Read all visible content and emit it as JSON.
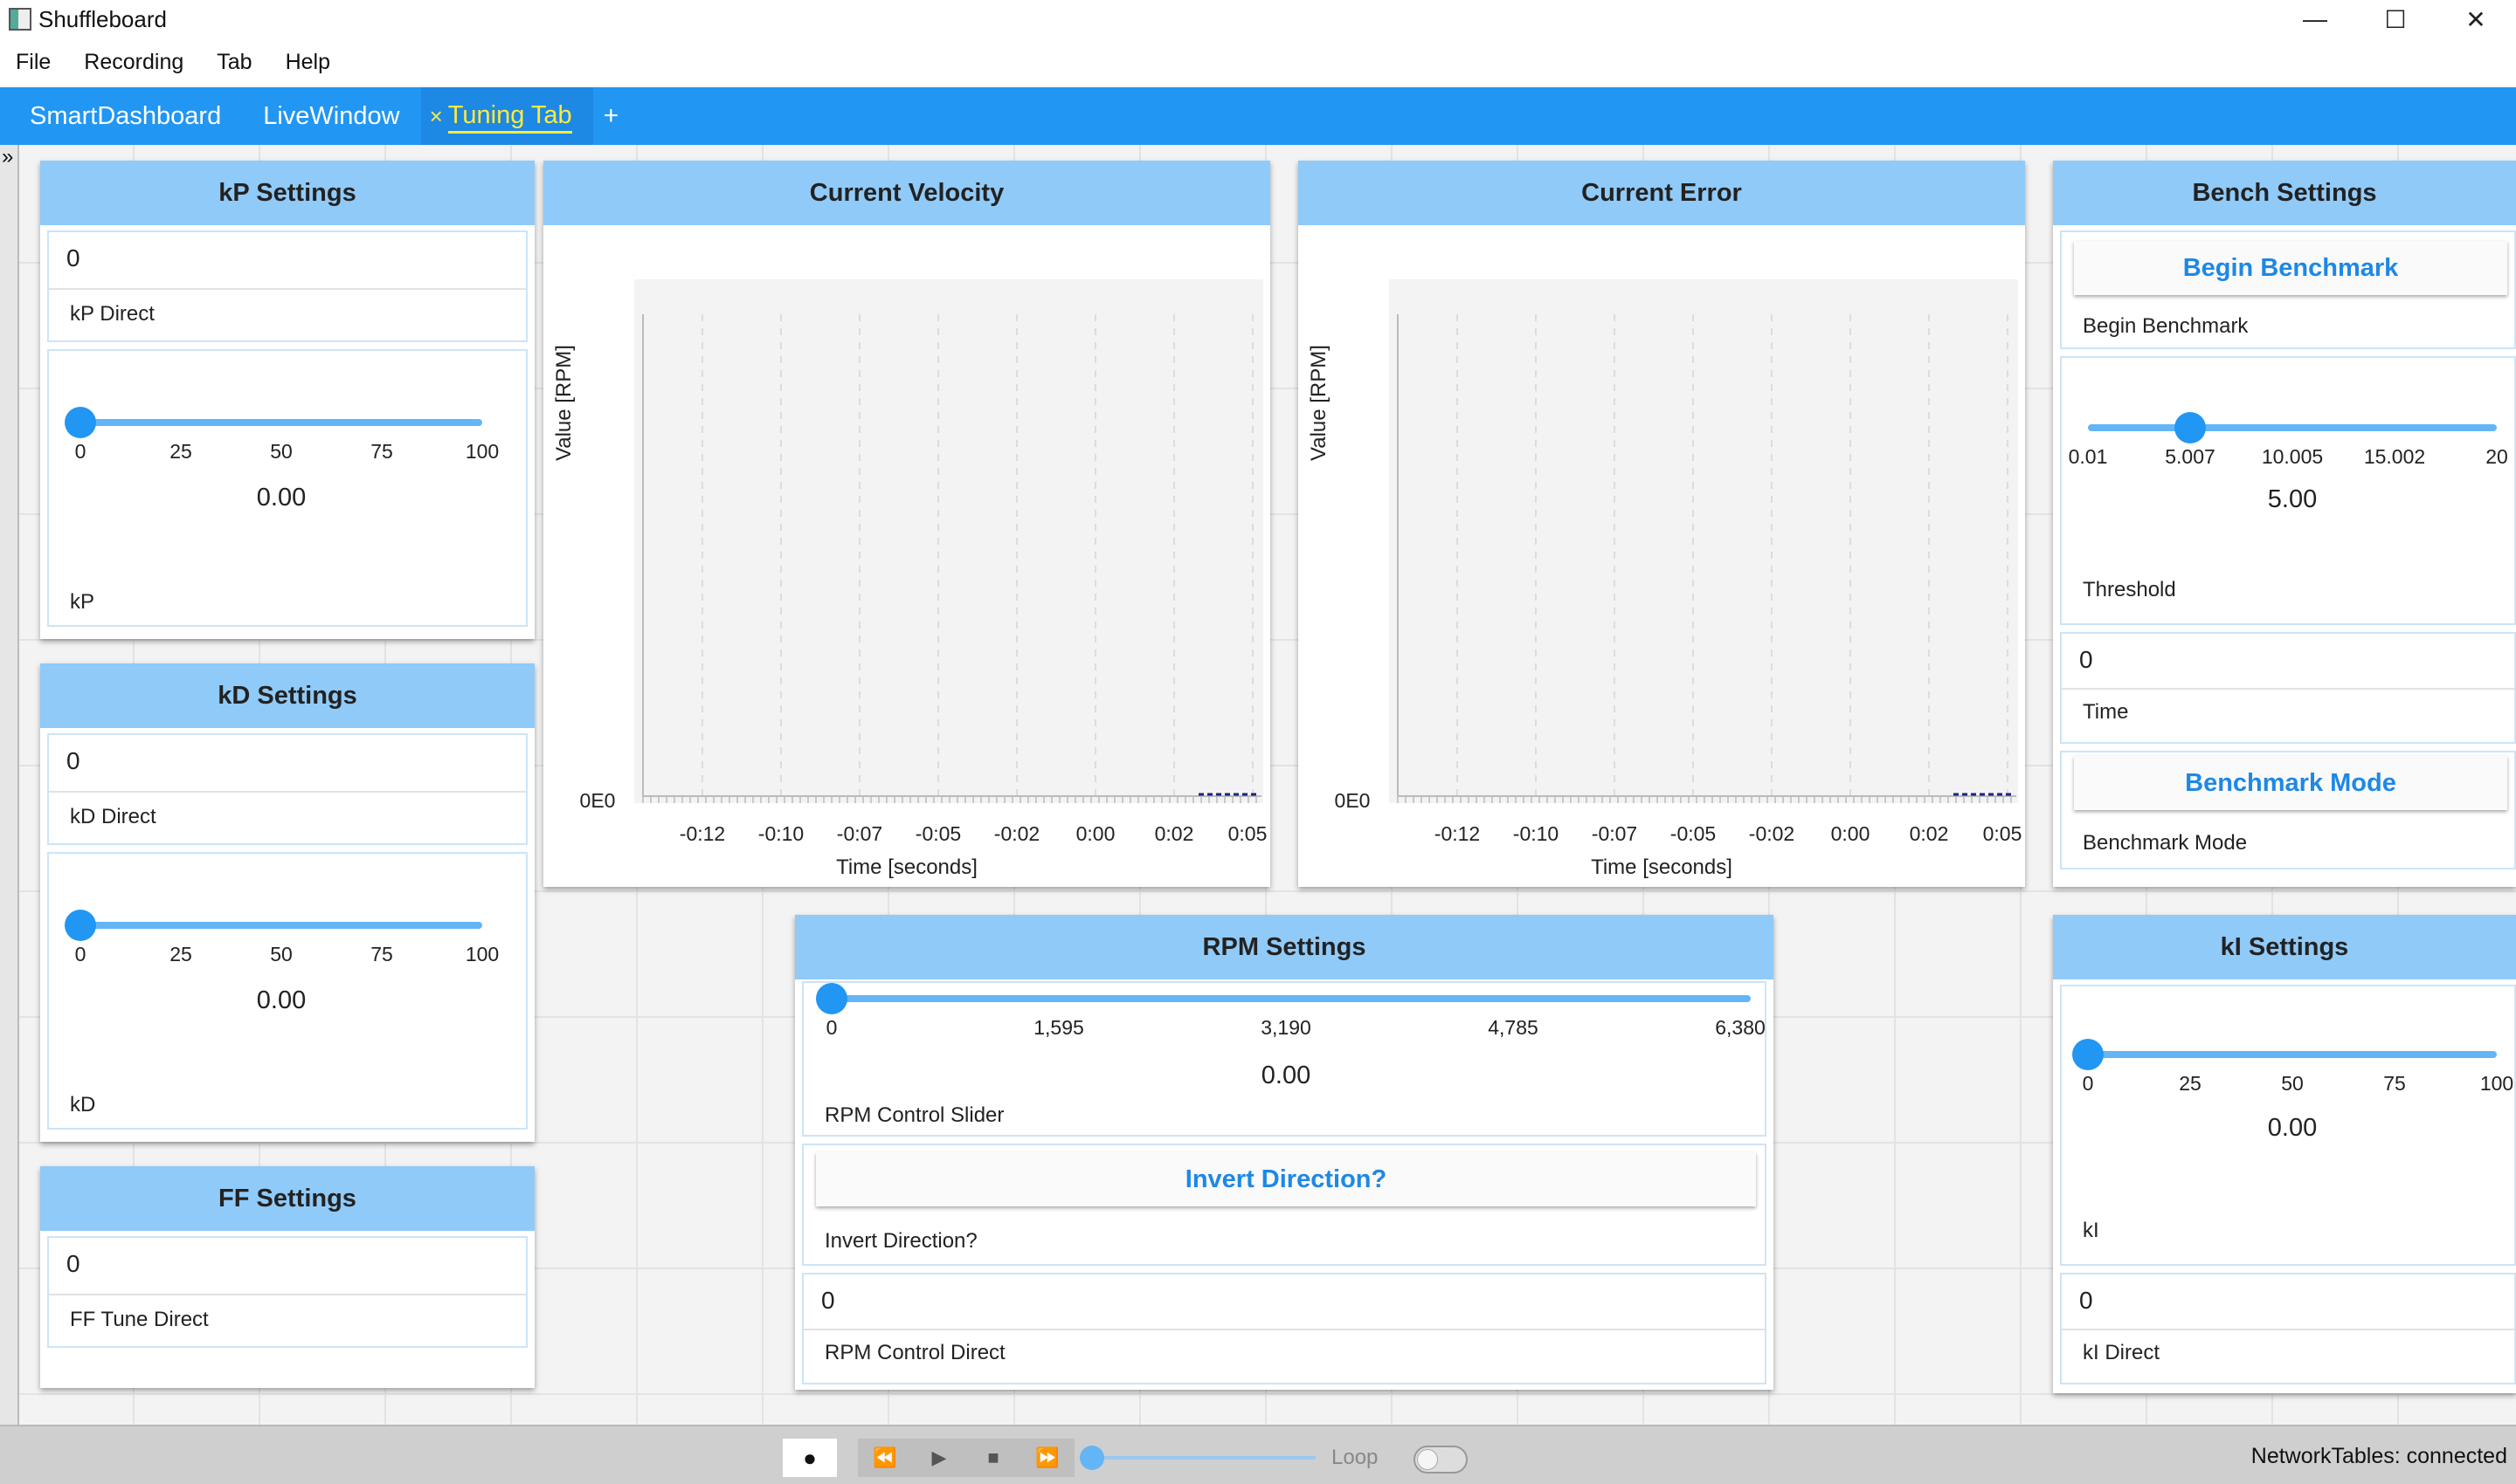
{
  "window": {
    "title": "Shuffleboard",
    "minimize": "—",
    "maximize": "☐",
    "close": "✕"
  },
  "menu": [
    "File",
    "Recording",
    "Tab",
    "Help"
  ],
  "tabs": [
    {
      "label": "SmartDashboard",
      "active": false
    },
    {
      "label": "LiveWindow",
      "active": false
    },
    {
      "label": "Tuning Tab",
      "active": true,
      "close": "×"
    }
  ],
  "add_tab": "+",
  "collapse_glyph": "»",
  "kp": {
    "title": "kP Settings",
    "direct_value": "0",
    "direct_label": "kP Direct",
    "slider_ticks": [
      "0",
      "25",
      "50",
      "75",
      "100"
    ],
    "slider_value": "0.00",
    "slider_fraction": 0,
    "slider_label": "kP"
  },
  "kd": {
    "title": "kD Settings",
    "direct_value": "0",
    "direct_label": "kD Direct",
    "slider_ticks": [
      "0",
      "25",
      "50",
      "75",
      "100"
    ],
    "slider_value": "0.00",
    "slider_fraction": 0,
    "slider_label": "kD"
  },
  "ff": {
    "title": "FF Settings",
    "direct_value": "0",
    "direct_label": "FF Tune Direct"
  },
  "velocity": {
    "title": "Current Velocity",
    "ylabel": "Value [RPM]",
    "xlabel": "Time [seconds]",
    "y_tick": "0E0",
    "x_ticks": [
      "-0:12",
      "-0:10",
      "-0:07",
      "-0:05",
      "-0:02",
      "0:00",
      "0:02",
      "0:05"
    ]
  },
  "error": {
    "title": "Current Error",
    "ylabel": "Value [RPM]",
    "xlabel": "Time [seconds]",
    "y_tick": "0E0",
    "x_ticks": [
      "-0:12",
      "-0:10",
      "-0:07",
      "-0:05",
      "-0:02",
      "0:00",
      "0:02",
      "0:05"
    ]
  },
  "bench": {
    "title": "Bench Settings",
    "begin_button": "Begin Benchmark",
    "begin_label": "Begin Benchmark",
    "threshold_ticks": [
      "0.01",
      "5.007",
      "10.005",
      "15.002",
      "20"
    ],
    "threshold_value": "5.00",
    "threshold_fraction": 0.25,
    "threshold_label": "Threshold",
    "time_value": "0",
    "time_label": "Time",
    "mode_button": "Benchmark Mode",
    "mode_label": "Benchmark Mode"
  },
  "rpm": {
    "title": "RPM Settings",
    "slider_ticks": [
      "0",
      "1,595",
      "3,190",
      "4,785",
      "6,380"
    ],
    "slider_value": "0.00",
    "slider_fraction": 0,
    "slider_label": "RPM Control Slider",
    "invert_button": "Invert Direction?",
    "invert_label": "Invert Direction?",
    "direct_value": "0",
    "direct_label": "RPM Control Direct"
  },
  "ki": {
    "title": "kI Settings",
    "slider_ticks": [
      "0",
      "25",
      "50",
      "75",
      "100"
    ],
    "slider_value": "0.00",
    "slider_fraction": 0,
    "slider_label": "kI",
    "direct_value": "0",
    "direct_label": "kI Direct"
  },
  "playback": {
    "record": "●",
    "rewind": "⏪",
    "play": "▶",
    "stop": "■",
    "forward": "⏩",
    "loop": "Loop",
    "position_fraction": 0
  },
  "status": "NetworkTables: connected",
  "colors": {
    "tab_bar": "#2196f3",
    "widget_header": "#90caf9",
    "accent": "#1e88e5",
    "active_tab_text": "#ffeb3b"
  }
}
